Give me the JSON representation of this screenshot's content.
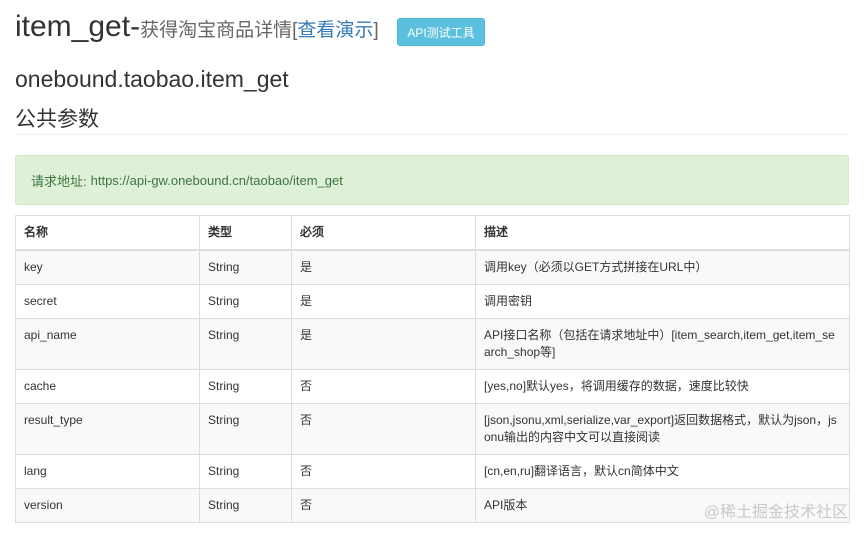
{
  "header": {
    "title_main": "item_get-",
    "title_sub": "获得淘宝商品详情",
    "bracket_open": "[",
    "demo_link": "查看演示",
    "bracket_close": "]",
    "api_tool_button": "API测试工具"
  },
  "method_name": "onebound.taobao.item_get",
  "section_title": "公共参数",
  "request_address": {
    "label": "请求地址:",
    "url": "https://api-gw.onebound.cn/taobao/item_get"
  },
  "table": {
    "headers": [
      "名称",
      "类型",
      "必须",
      "描述"
    ],
    "rows": [
      [
        "key",
        "String",
        "是",
        "调用key（必须以GET方式拼接在URL中）"
      ],
      [
        "secret",
        "String",
        "是",
        "调用密钥"
      ],
      [
        "api_name",
        "String",
        "是",
        "API接口名称（包括在请求地址中）[item_search,item_get,item_search_shop等]"
      ],
      [
        "cache",
        "String",
        "否",
        "[yes,no]默认yes，将调用缓存的数据，速度比较快"
      ],
      [
        "result_type",
        "String",
        "否",
        "[json,jsonu,xml,serialize,var_export]返回数据格式，默认为json，jsonu输出的内容中文可以直接阅读"
      ],
      [
        "lang",
        "String",
        "否",
        "[cn,en,ru]翻译语言，默认cn简体中文"
      ],
      [
        "version",
        "String",
        "否",
        "API版本"
      ]
    ]
  },
  "watermark": "@稀土掘金技术社区"
}
